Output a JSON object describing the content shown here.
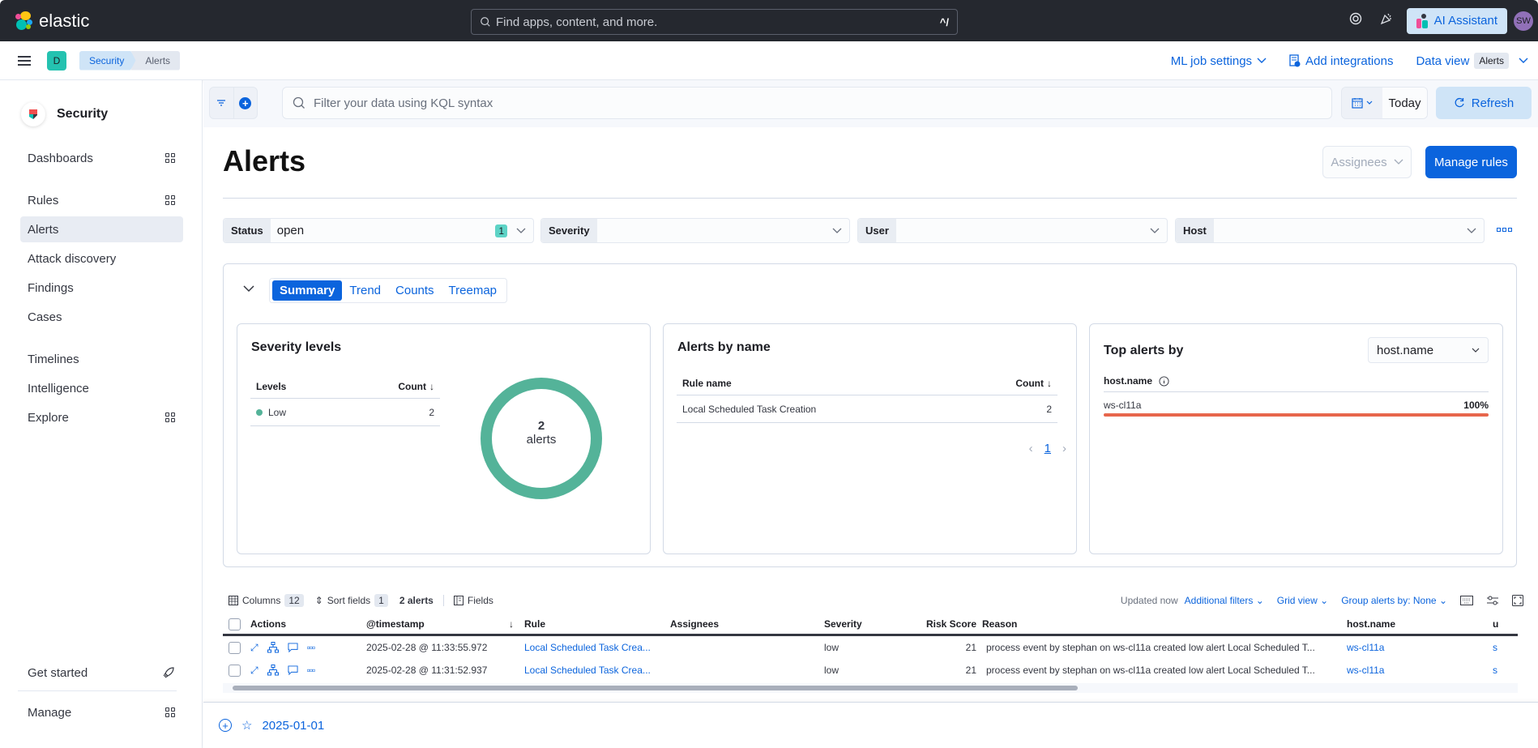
{
  "header": {
    "logo_text": "elastic",
    "search_placeholder": "Find apps, content, and more.",
    "search_shortcut": "^/",
    "ai_assistant_label": "AI Assistant",
    "avatar_initials": "SW"
  },
  "subheader": {
    "space_initial": "D",
    "breadcrumbs": [
      "Security",
      "Alerts"
    ],
    "ml_job_settings": "ML job settings",
    "add_integrations": "Add integrations",
    "data_view_label": "Data view",
    "data_view_value": "Alerts"
  },
  "sidebar": {
    "title": "Security",
    "items": [
      {
        "label": "Dashboards",
        "has_grid_icon": true
      },
      {
        "label": "Rules",
        "has_grid_icon": true
      },
      {
        "label": "Alerts",
        "active": true
      },
      {
        "label": "Attack discovery"
      },
      {
        "label": "Findings"
      },
      {
        "label": "Cases"
      },
      {
        "label": "Timelines"
      },
      {
        "label": "Intelligence"
      },
      {
        "label": "Explore",
        "has_grid_icon": true
      }
    ],
    "footer": {
      "get_started": "Get started",
      "manage": "Manage"
    }
  },
  "querybar": {
    "kql_placeholder": "Filter your data using KQL syntax",
    "date_value": "Today",
    "refresh_label": "Refresh"
  },
  "page": {
    "title": "Alerts",
    "assignees_label": "Assignees",
    "manage_rules_label": "Manage rules"
  },
  "filters": [
    {
      "label": "Status",
      "value": "open",
      "badge": "1"
    },
    {
      "label": "Severity",
      "value": ""
    },
    {
      "label": "User",
      "value": ""
    },
    {
      "label": "Host",
      "value": ""
    }
  ],
  "summary": {
    "tabs": [
      "Summary",
      "Trend",
      "Counts",
      "Treemap"
    ],
    "active_tab": "Summary",
    "severity_levels": {
      "title": "Severity levels",
      "col_levels": "Levels",
      "col_count": "Count",
      "rows": [
        {
          "level": "Low",
          "count": "2",
          "color": "#54b399"
        }
      ],
      "donut_total": "2",
      "donut_unit": "alerts"
    },
    "alerts_by_name": {
      "title": "Alerts by name",
      "col_rule": "Rule name",
      "col_count": "Count",
      "rows": [
        {
          "rule": "Local Scheduled Task Creation",
          "count": "2"
        }
      ],
      "page": "1"
    },
    "top_alerts_by": {
      "title": "Top alerts by",
      "selected_field": "host.name",
      "field_label": "host.name",
      "rows": [
        {
          "value": "ws-cl11a",
          "percent": 100,
          "percent_label": "100%",
          "color": "#e7664c"
        }
      ]
    }
  },
  "grid": {
    "toolbar": {
      "columns_label": "Columns",
      "columns_count": "12",
      "sort_label": "Sort fields",
      "sort_count": "1",
      "alerts_count": "2 alerts",
      "fields_label": "Fields",
      "updated": "Updated now",
      "additional_filters": "Additional filters",
      "grid_view": "Grid view",
      "group_by": "Group alerts by: None"
    },
    "columns": [
      "Actions",
      "@timestamp",
      "Rule",
      "Assignees",
      "Severity",
      "Risk Score",
      "Reason",
      "host.name",
      "u"
    ],
    "rows": [
      {
        "timestamp": "2025-02-28 @ 11:33:55.972",
        "rule": "Local Scheduled Task Crea...",
        "assignees": "",
        "severity": "low",
        "risk": "21",
        "reason": "process event by stephan on ws-cl11a created low alert Local Scheduled T...",
        "host": "ws-cl11a",
        "user": "s"
      },
      {
        "timestamp": "2025-02-28 @ 11:31:52.937",
        "rule": "Local Scheduled Task Crea...",
        "assignees": "",
        "severity": "low",
        "risk": "21",
        "reason": "process event by stephan on ws-cl11a created low alert Local Scheduled T...",
        "host": "ws-cl11a",
        "user": "s"
      }
    ]
  },
  "timeline": {
    "title": "2025-01-01"
  }
}
